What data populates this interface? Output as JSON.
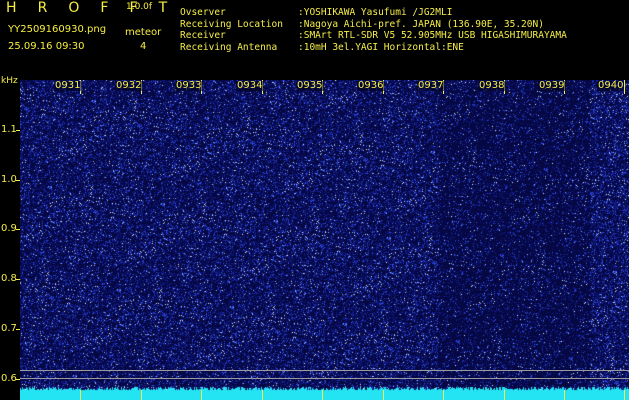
{
  "header": {
    "title": "H R O F F T",
    "version": "1.0.0f",
    "filename": "YY2509160930.png",
    "meteor_label": "meteor",
    "datetime": "25.09.16 09:30",
    "meteor_count": "4"
  },
  "info": [
    {
      "key": "Ovserver",
      "value": ":YOSHIKAWA Yasufumi /JG2MLI"
    },
    {
      "key": "Receiving Location",
      "value": ":Nagoya Aichi-pref. JAPAN (136.90E, 35.20N)"
    },
    {
      "key": "Receiver",
      "value": ":SMArt RTL-SDR V5 52.905MHz USB HIGASHIMURAYAMA"
    },
    {
      "key": "Receiving Antenna",
      "value": ":10mH 3el.YAGI Horizontal:ENE"
    }
  ],
  "axis": {
    "y_unit": "kHz",
    "y_ticks": [
      "1.1",
      "1.0",
      "0.9",
      "0.8",
      "0.7",
      "0.6"
    ],
    "x_ticks": [
      "0931",
      "0932",
      "0933",
      "0934",
      "0935",
      "0936",
      "0937",
      "0938",
      "0939",
      "0940"
    ]
  },
  "colors": {
    "background": "#000000",
    "text": "#f5ee4a",
    "spectrogram_base": "#050842",
    "noise_bright": "#3a5cff",
    "signal_band": "#24e4f4",
    "reference_line": "#9a9a9a"
  }
}
